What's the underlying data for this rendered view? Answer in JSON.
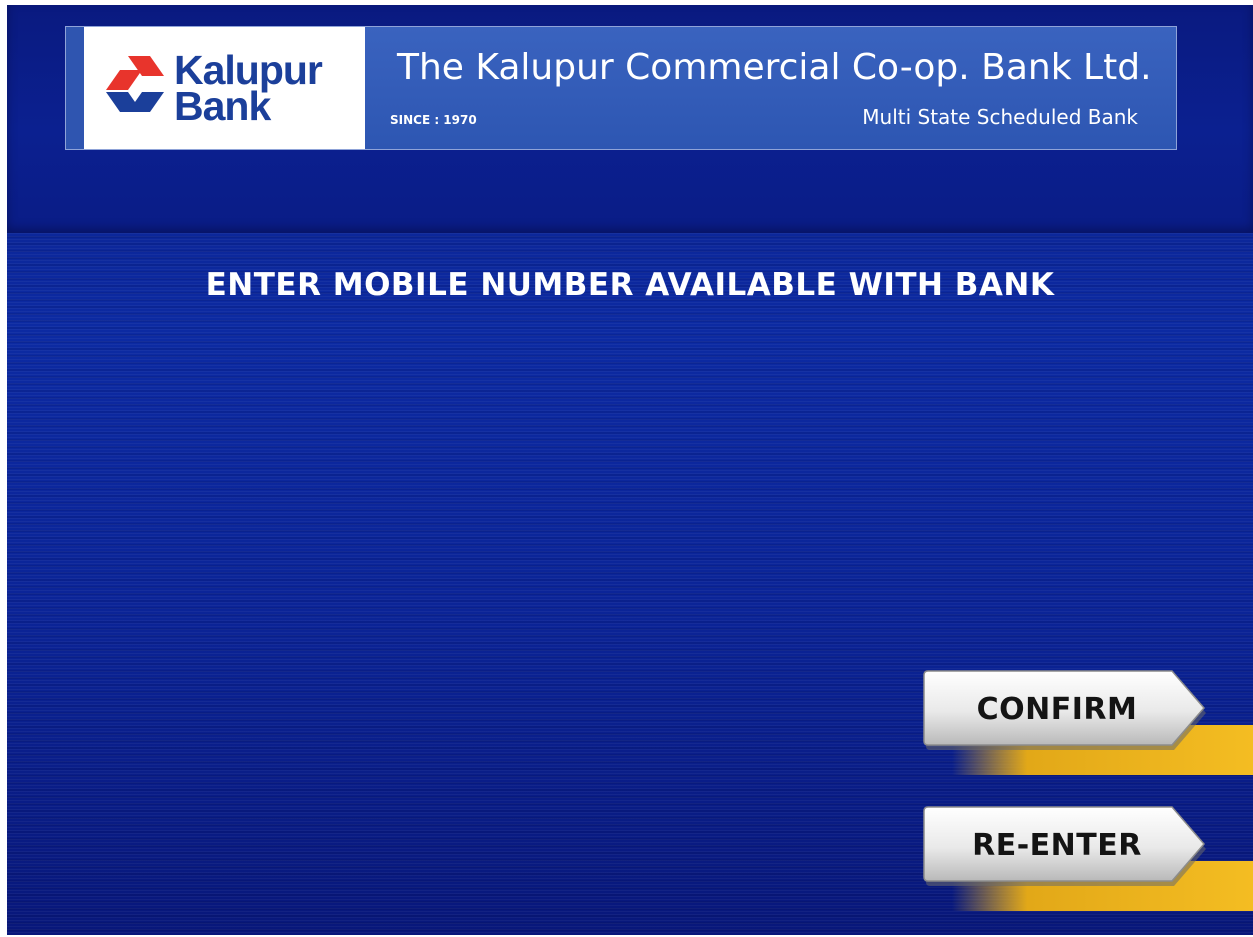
{
  "header": {
    "logo_line1": "Kalupur",
    "logo_line2": "Bank",
    "bank_name": "The Kalupur Commercial Co-op. Bank Ltd.",
    "since": "SINCE : 1970",
    "tagline": "Multi State Scheduled Bank"
  },
  "main": {
    "prompt": "ENTER MOBILE NUMBER AVAILABLE WITH BANK"
  },
  "buttons": {
    "confirm_label": "CONFIRM",
    "reenter_label": "RE-ENTER"
  },
  "colors": {
    "background_blue": "#0c2aa2",
    "logo_red": "#e8342c",
    "logo_blue": "#1b3f9a",
    "button_accent": "#f2b81e"
  }
}
